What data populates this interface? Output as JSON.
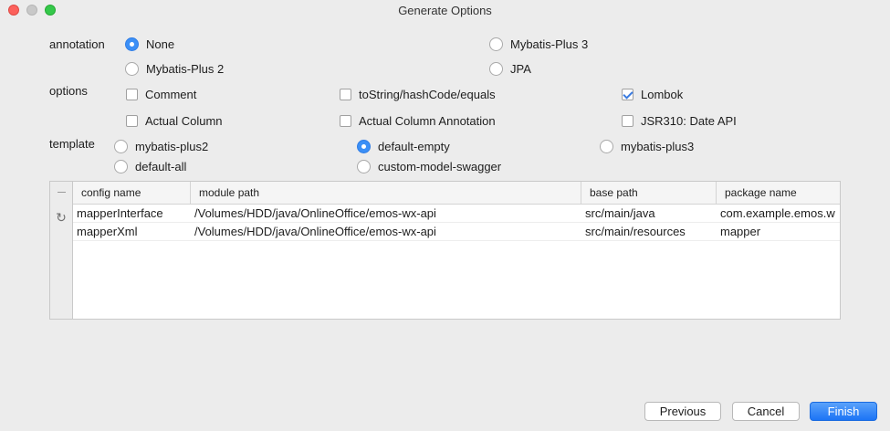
{
  "window": {
    "title": "Generate Options"
  },
  "annotation": {
    "label": "annotation",
    "options": [
      "None",
      "Mybatis-Plus 3",
      "Mybatis-Plus 2",
      "JPA"
    ],
    "selected": "None"
  },
  "options": {
    "label": "options",
    "items": [
      {
        "label": "Comment",
        "checked": false
      },
      {
        "label": "toString/hashCode/equals",
        "checked": false
      },
      {
        "label": "Lombok",
        "checked": true
      },
      {
        "label": "Actual Column",
        "checked": false
      },
      {
        "label": "Actual Column Annotation",
        "checked": false
      },
      {
        "label": "JSR310: Date API",
        "checked": false
      }
    ]
  },
  "template": {
    "label": "template",
    "options": [
      "mybatis-plus2",
      "default-empty",
      "mybatis-plus3",
      "default-all",
      "custom-model-swagger"
    ],
    "selected": "default-empty"
  },
  "table": {
    "columns": [
      "config name",
      "module path",
      "base path",
      "package name"
    ],
    "rows": [
      [
        "mapperInterface",
        "/Volumes/HDD/java/OnlineOffice/emos-wx-api",
        "src/main/java",
        "com.example.emos.w"
      ],
      [
        "mapperXml",
        "/Volumes/HDD/java/OnlineOffice/emos-wx-api",
        "src/main/resources",
        "mapper"
      ]
    ],
    "side_icons": [
      "minus-icon",
      "refresh-icon"
    ]
  },
  "buttons": {
    "previous": "Previous",
    "cancel": "Cancel",
    "finish": "Finish"
  },
  "colors": {
    "accent": "#3b8ff6",
    "primary_button": "#1c74f5"
  }
}
